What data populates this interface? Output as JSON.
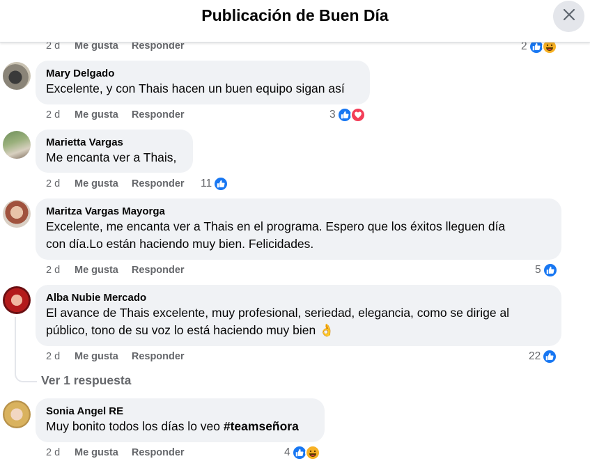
{
  "header": {
    "title": "Publicación de Buen Día"
  },
  "actions": {
    "like": "Me gusta",
    "reply": "Responder"
  },
  "top_row": {
    "time": "2 d",
    "reaction_count": "2"
  },
  "comments": [
    {
      "name": "Mary Delgado",
      "text": "Excelente, y con Thais hacen un buen equipo sigan así",
      "time": "2 d",
      "reaction_count": "3"
    },
    {
      "name": "Marietta Vargas",
      "text": "Me encanta ver a Thais,",
      "time": "2 d",
      "reaction_count": "11"
    },
    {
      "name": "Maritza Vargas Mayorga",
      "text_line1": "Excelente, me encanta ver a Thais en el programa. Espero que los éxitos lleguen día",
      "text_line2": "con día.Lo están haciendo muy bien. Felicidades.",
      "time": "2 d",
      "reaction_count": "5"
    },
    {
      "name": "Alba Nubie Mercado",
      "text_line1": "El avance de Thais excelente, muy profesional, seriedad, elegancia, como se dirige al",
      "text_line2": "público, tono de su voz lo está haciendo muy bien",
      "emoji": "👌",
      "time": "2 d",
      "reaction_count": "22",
      "view_replies": "Ver 1 respuesta"
    },
    {
      "name": "Sonia Angel RE",
      "text": "Muy bonito todos los días lo veo ",
      "hashtag": "#teamseñora",
      "time": "2 d",
      "reaction_count": "4"
    }
  ],
  "colors": {
    "like": "#1877f2",
    "love": "#f33e58",
    "haha": "#f7b125",
    "bubble": "#f0f2f5",
    "meta": "#65676b"
  }
}
